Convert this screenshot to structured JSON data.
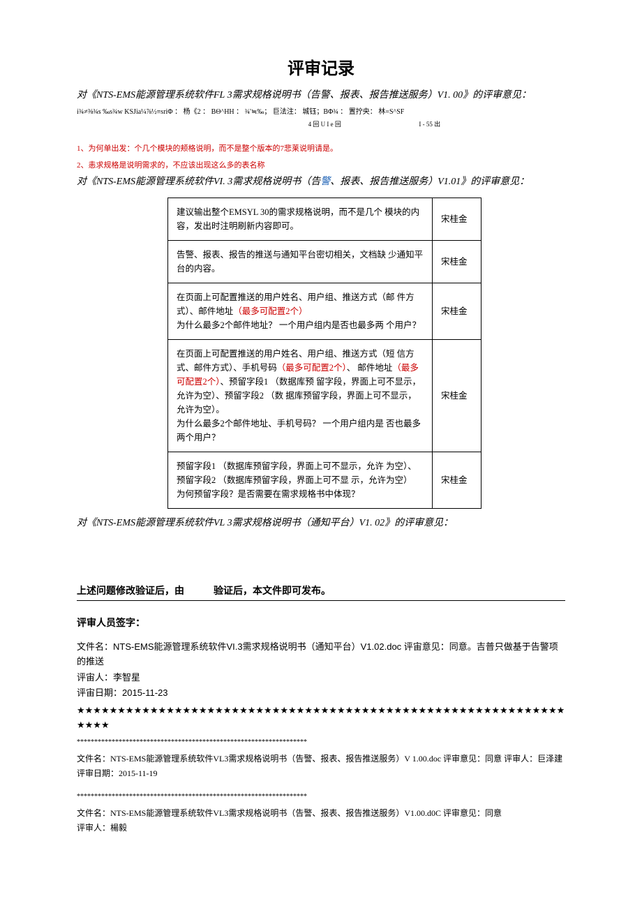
{
  "title": "评审记录",
  "section1": {
    "heading": "对《NTS-EMS能源管理系统软件FL 3需求规格说明书（告警、报表、报告推送服务）V1. 00》的评审意见：",
    "garbled1": "i¾≠⅜¾s ‰s¾w KSJia­¼⅞½≡sriΦ ： 杨《2 ： BΘ^HH ： ¾'≒‰； 巨法注： 城钰；BΦ¾ ： 置拧央： 林=S^SF",
    "garbled2_left": "4 回 U I e 回",
    "garbled2_right": "I - 55 出",
    "notes": [
      "1、为何单出发：个几个模块的颊格说明，而不是整个版本的7悲莱说明请是。",
      "2、恚求规格是说明需求的，不应该出现这么多的表名称"
    ]
  },
  "section2": {
    "heading_pre": "对《NTS-EMS能源管理系统软件VI. 3需求规格说明书（告",
    "heading_blue": "警",
    "heading_post": "、报表、报告推送服务）V1.01》的评审意见：",
    "rows": [
      {
        "text": "建议输出整个EMSYL 30的需求规格说明，而不是几个 模块的内容，发出时注明刷新内容即可。",
        "name": "宋桂金"
      },
      {
        "text": "告警、报表、报告的推送与通知平台密切相关，文档缺 少通知平台的内容。",
        "name": "宋桂金"
      },
      {
        "pre": "在页面上可配置推送的用户姓名、用户组、推送方式（邮 件方式）、邮件地址",
        "red": "（最多可配置2个）",
        "post": "\n为什么最多2个邮件地址？ 一个用户组内是否也最多两 个用户？",
        "name": "宋桂金"
      },
      {
        "pre": "在页面上可配置推送的用户姓名、用户组、推送方式（短 信方式、邮件方式）、手机号码",
        "red": "（最多可配置2个）",
        "mid": "、 邮件地址",
        "red2": "（最多可配置2个）",
        "post": "、预留字段1 （数据库预 留字段，界面上可不显示，允许为空）、预留字段2 （数 据库预留字段，界面上可不显示，允许为空）。\n为什么最多2个邮件地址、手机号码？ 一个用户组内是 否也最多两个用户？",
        "name": "宋桂金"
      },
      {
        "text": "预留字段1 （数据库预留字段，界面上可不显示，允许 为空）、预留字段2 （数据库预留字段，界面上可不显 示，允许为空）\n为何预留字段？是否需要在需求规格书中体现？",
        "name": "宋桂金"
      }
    ]
  },
  "section3": {
    "heading": "对《NTS-EMS能源管理系统软件VL 3需求规格说明书（通知平台）V1. 02》的评审意见："
  },
  "conclusion": {
    "line": "上述问题修改验证后，由　　　验证后，本文件即可发布。",
    "sig_label": "评审人员签字："
  },
  "blocks": [
    {
      "l1": "文件名：NTS-EMS能源管理系统软件VI.3需求规格说明书（通知平台）V1.02.doc 评宙意见：同意。吉普只做基于告警项的推送",
      "l2": "评宙人：李智星",
      "l3": "评宙日期：2015-11-23",
      "stars": "★★★★★★★★★★★★★★★★★★★★★★★★★★★★★★★★★★★★★★★★★★★★★★★★★★★★★★★★★★★★★★★★",
      "asterisks": "******************************************************************"
    },
    {
      "l1": "文件名：NTS-EMS能源管理系统软件VL3需求规格说明书（告警、报表、报告推送服务）V 1.00.doc 评审意见：同意 评审人：巨泽建",
      "l2": "评审日期：2015-11-19",
      "asterisks": "******************************************************************"
    },
    {
      "l1": "文件名：NTS-EMS能源管理系统软件VL3需求规格说明书（告警、报表、报告推送服务）V1.00.d0C 评审意见：同意",
      "l2": "评审人：楊毅"
    }
  ]
}
